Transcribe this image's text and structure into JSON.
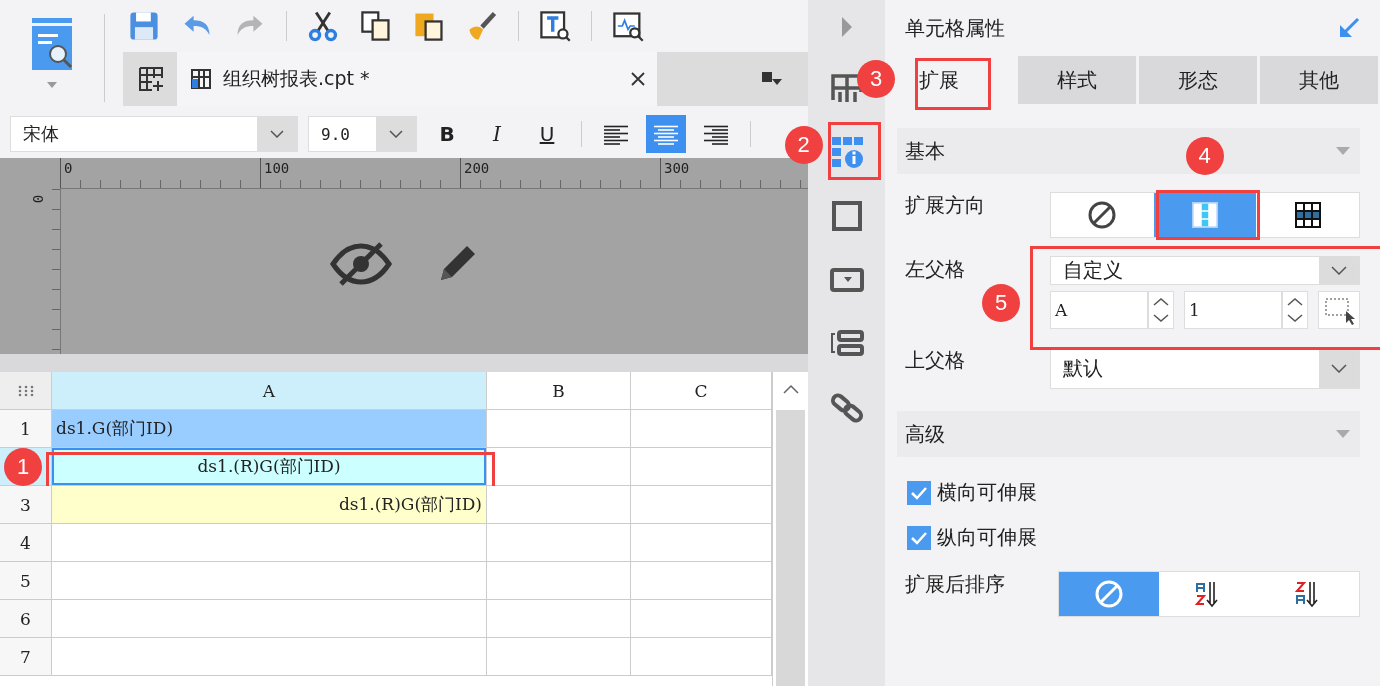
{
  "toolbar": [
    {
      "kind": "save",
      "disabled": false
    },
    {
      "kind": "undo",
      "disabled": false
    },
    {
      "kind": "redo",
      "disabled": true
    },
    {
      "kind": "cut",
      "disabled": false
    },
    {
      "kind": "copy",
      "disabled": false
    },
    {
      "kind": "paste",
      "disabled": false
    },
    {
      "kind": "brush",
      "disabled": false
    },
    {
      "kind": "text-search",
      "disabled": false
    },
    {
      "kind": "preview",
      "disabled": false
    }
  ],
  "file_tab": {
    "title": "组织树报表.cpt *"
  },
  "font": {
    "family": "宋体",
    "size": "9.0"
  },
  "style_buttons": [
    {
      "kind": "bold",
      "label": "B"
    },
    {
      "kind": "italic",
      "label": "I"
    },
    {
      "kind": "underline",
      "label": "U"
    }
  ],
  "align_buttons": [
    {
      "kind": "left",
      "selected": false
    },
    {
      "kind": "center",
      "selected": true
    },
    {
      "kind": "right",
      "selected": false
    }
  ],
  "ruler": {
    "labels": [
      "0",
      "100",
      "200",
      "300"
    ],
    "side_label": "0"
  },
  "grid": {
    "columns": [
      {
        "label": "A",
        "selected": true
      },
      {
        "label": "B",
        "selected": false
      },
      {
        "label": "C",
        "selected": false
      }
    ],
    "rows": [
      {
        "number": "1",
        "selected": false,
        "cell": "ds1.G(部门ID)",
        "kind": "left",
        "color": "#99ccff"
      },
      {
        "selected": true,
        "cell": "ds1.(R)G(部门ID)",
        "kind": "center",
        "color": "#ccffff",
        "badge": "1"
      },
      {
        "number": "3",
        "selected": false,
        "cell": "ds1.(R)G(部门ID)",
        "kind": "right",
        "color": "#ffffcc"
      },
      {
        "number": "4",
        "selected": false
      },
      {
        "number": "5",
        "selected": false
      },
      {
        "number": "6",
        "selected": false
      },
      {
        "number": "7",
        "selected": false
      }
    ]
  },
  "side_tabs": [
    {
      "kind": "cell-element",
      "selected": false
    },
    {
      "kind": "cell-attribute",
      "selected": true,
      "badge": "2"
    },
    {
      "kind": "border",
      "selected": false
    },
    {
      "kind": "widget",
      "selected": false
    },
    {
      "kind": "condition",
      "selected": false
    },
    {
      "kind": "link",
      "selected": false
    }
  ],
  "panel": {
    "title": "单元格属性",
    "tabs": [
      {
        "label": "扩展",
        "selected": true,
        "badge": "3"
      },
      {
        "label": "样式",
        "selected": false
      },
      {
        "label": "形态",
        "selected": false
      },
      {
        "label": "其他",
        "selected": false
      }
    ],
    "basic": {
      "title": "基本",
      "direction": {
        "label": "扩展方向",
        "options": [
          {
            "kind": "none",
            "selected": false
          },
          {
            "kind": "vertical",
            "selected": true,
            "badge": "4"
          },
          {
            "kind": "horizontal",
            "selected": false
          }
        ]
      },
      "left_parent": {
        "label": "左父格",
        "value": "自定义",
        "column": "A",
        "row": "1",
        "badge": "5"
      },
      "top_parent": {
        "label": "上父格",
        "value": "默认"
      }
    },
    "advanced": {
      "title": "高级",
      "checks": [
        {
          "label": "横向可伸展",
          "checked": true
        },
        {
          "label": "纵向可伸展",
          "checked": true
        }
      ],
      "sort": {
        "label": "扩展后排序",
        "options": [
          {
            "kind": "none",
            "selected": true
          },
          {
            "kind": "ascending",
            "selected": false
          },
          {
            "kind": "descending",
            "selected": false
          }
        ]
      }
    }
  }
}
